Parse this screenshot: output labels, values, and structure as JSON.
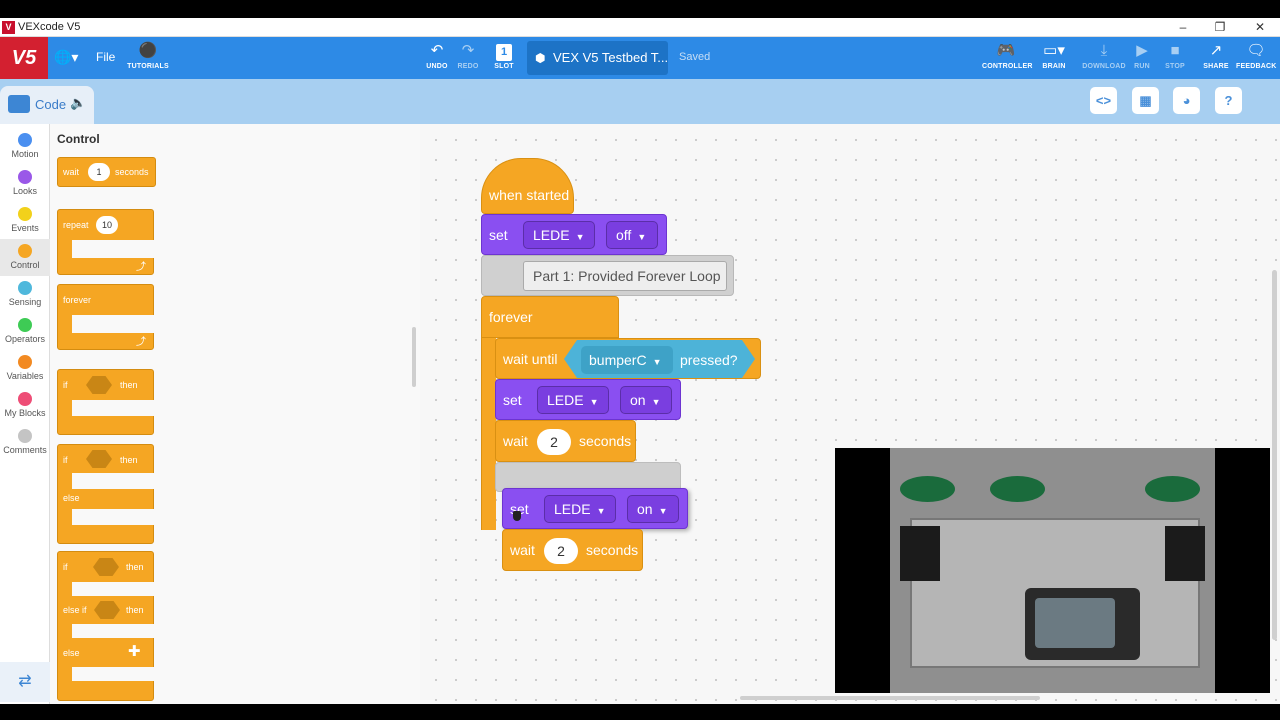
{
  "window": {
    "title": "VEXcode V5",
    "app_icon": "vex-icon"
  },
  "toolbar": {
    "logo": "V5",
    "file": "File",
    "tutorials": "TUTORIALS",
    "undo": "UNDO",
    "redo": "REDO",
    "slot": "SLOT",
    "slot_number": "1",
    "project_name": "VEX V5 Testbed T...",
    "status": "Saved",
    "controller": "CONTROLLER",
    "brain": "BRAIN",
    "download": "DOWNLOAD",
    "run": "RUN",
    "stop": "STOP",
    "share": "SHARE",
    "feedback": "FEEDBACK"
  },
  "tabs": {
    "code": "Code"
  },
  "categories": [
    {
      "label": "Motion",
      "color": "#4a8ff0"
    },
    {
      "label": "Looks",
      "color": "#9a58e8"
    },
    {
      "label": "Events",
      "color": "#f2d11b"
    },
    {
      "label": "Control",
      "color": "#f5a623"
    },
    {
      "label": "Sensing",
      "color": "#4fb8dc"
    },
    {
      "label": "Operators",
      "color": "#3ecb55"
    },
    {
      "label": "Variables",
      "color": "#f28a22"
    },
    {
      "label": "My Blocks",
      "color": "#ee4d76"
    },
    {
      "label": "Comments",
      "color": "#c4c4c4"
    }
  ],
  "palette": {
    "heading": "Control",
    "wait": "wait",
    "wait_value": "1",
    "seconds": "seconds",
    "repeat": "repeat",
    "repeat_value": "10",
    "forever": "forever",
    "if": "if",
    "then": "then",
    "else": "else",
    "else_if": "else if"
  },
  "script": {
    "hat": "when started",
    "set": "set",
    "device": "LEDE",
    "off": "off",
    "on": "on",
    "comment": "Part 1: Provided Forever Loop",
    "forever": "forever",
    "wait_until": "wait until",
    "sensor": "bumperC",
    "pressed": "pressed?",
    "wait": "wait",
    "wait_value": "2",
    "seconds": "seconds"
  }
}
